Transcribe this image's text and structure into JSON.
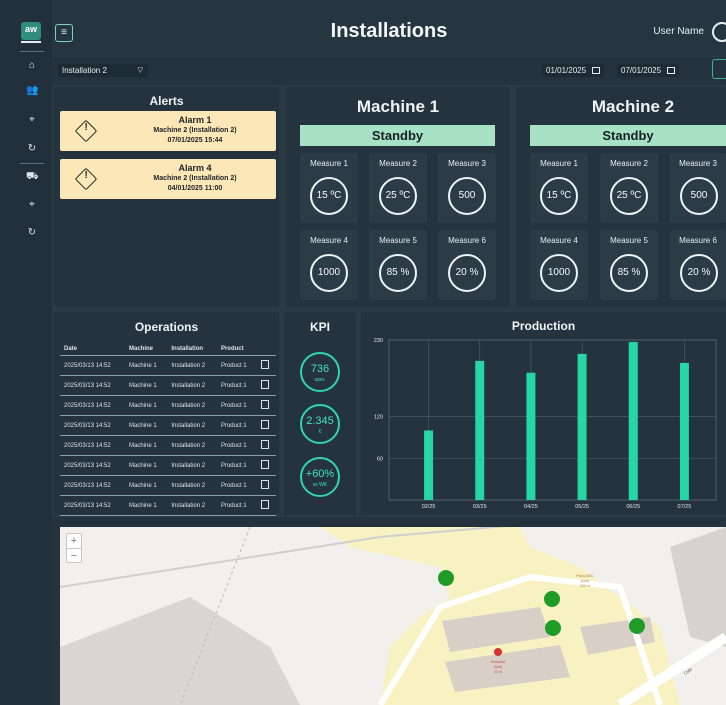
{
  "header": {
    "title": "Installations",
    "user_name": "User Name",
    "menu_glyph": "≡"
  },
  "sidebar": {
    "logo": "aw",
    "icons": [
      "home-icon",
      "users-icon",
      "location-icon",
      "refresh-icon",
      "truck-icon",
      "location-icon",
      "refresh-icon"
    ]
  },
  "filters": {
    "installation": "Installation 2",
    "date_from": "01/01/2025",
    "date_to": "07/01/2025"
  },
  "alerts": {
    "title": "Alerts",
    "items": [
      {
        "title": "Alarm 1",
        "machine": "Machine 2 (Installation 2)",
        "date": "07/01/2025 15:44"
      },
      {
        "title": "Alarm 4",
        "machine": "Machine 2 (Installation 2)",
        "date": "04/01/2025 11:00"
      }
    ]
  },
  "machines": [
    {
      "name": "Machine 1",
      "status": "Standby",
      "measures": [
        {
          "label": "Measure 1",
          "value": "15 ºC"
        },
        {
          "label": "Measure 2",
          "value": "25 ºC"
        },
        {
          "label": "Measure 3",
          "value": "500"
        },
        {
          "label": "Measure 4",
          "value": "1000"
        },
        {
          "label": "Measure 5",
          "value": "85 %"
        },
        {
          "label": "Measure 6",
          "value": "20 %"
        }
      ]
    },
    {
      "name": "Machine 2",
      "status": "Standby",
      "measures": [
        {
          "label": "Measure 1",
          "value": "15 ºC"
        },
        {
          "label": "Measure 2",
          "value": "25 ºC"
        },
        {
          "label": "Measure 3",
          "value": "500"
        },
        {
          "label": "Measure 4",
          "value": "1000"
        },
        {
          "label": "Measure 5",
          "value": "85 %"
        },
        {
          "label": "Measure 6",
          "value": "20 %"
        }
      ]
    }
  ],
  "operations": {
    "title": "Operations",
    "columns": [
      "Date",
      "Machine",
      "Installation",
      "Product"
    ],
    "rows": [
      [
        "2025/03/13 14:52",
        "Machine 1",
        "Installation 2",
        "Product 1"
      ],
      [
        "2025/03/13 14:52",
        "Machine 1",
        "Installation 2",
        "Product 1"
      ],
      [
        "2025/03/13 14:52",
        "Machine 1",
        "Installation 2",
        "Product 1"
      ],
      [
        "2025/03/13 14:52",
        "Machine 1",
        "Installation 2",
        "Product 1"
      ],
      [
        "2025/03/13 14:52",
        "Machine 1",
        "Installation 2",
        "Product 1"
      ],
      [
        "2025/03/13 14:52",
        "Machine 1",
        "Installation 2",
        "Product 1"
      ],
      [
        "2025/03/13 14:52",
        "Machine 1",
        "Installation 2",
        "Product 1"
      ],
      [
        "2025/03/13 14:52",
        "Machine 1",
        "Installation 2",
        "Product 1"
      ],
      [
        "2025/03/13 14:52",
        "Machine 1",
        "Installation 2",
        "Product 1"
      ]
    ]
  },
  "kpi": {
    "title": "KPI",
    "items": [
      {
        "value": "736",
        "sub": "oper."
      },
      {
        "value": "2.345",
        "sub": "€"
      },
      {
        "value": "+60%",
        "sub": "vs WK"
      }
    ]
  },
  "production": {
    "title": "Production",
    "bar_color": "#27d6a5"
  },
  "chart_data": {
    "type": "bar",
    "title": "Production",
    "categories": [
      "02/25",
      "03/25",
      "04/25",
      "05/25",
      "06/25",
      "07/25"
    ],
    "values": [
      100,
      200,
      183,
      210,
      227,
      197
    ],
    "ylim": [
      0,
      230
    ],
    "yticks": [
      60,
      120,
      230
    ],
    "grid": true
  },
  "map": {
    "zoom_in": "+",
    "zoom_out": "−",
    "markers": 4,
    "marker_color": "#1f9c28",
    "labels": {
      "parking": "Parq ABC",
      "parking_sub1": "(sub)",
      "parking_sub2": "520 m",
      "hospital": "Hospital",
      "hospital_sub1": "(sub)",
      "hospital_sub2": "40 m",
      "street": "Calle"
    }
  }
}
